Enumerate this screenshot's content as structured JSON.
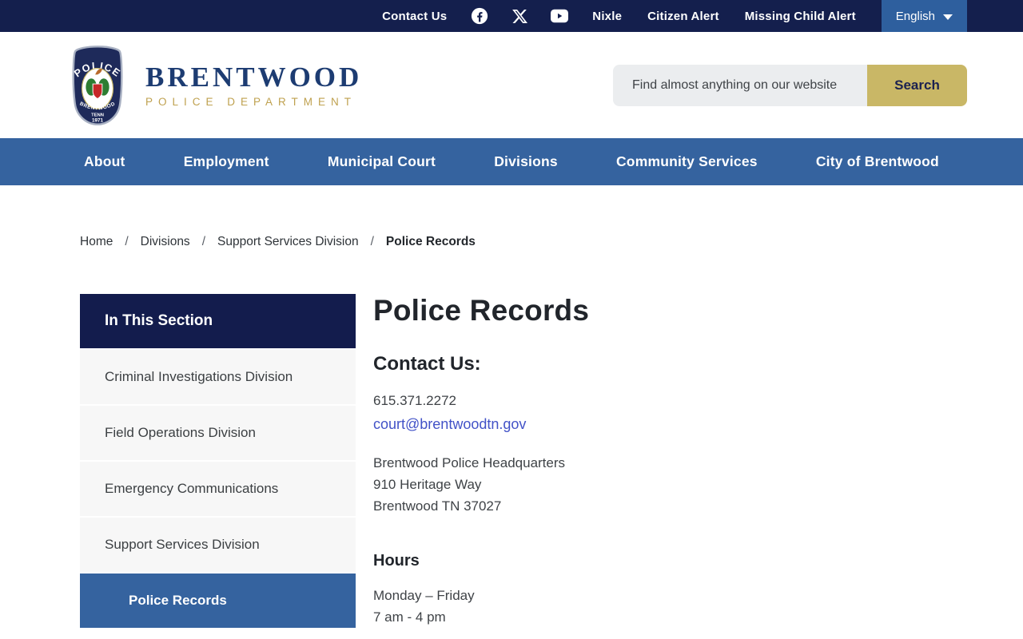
{
  "topbar": {
    "contact_us": "Contact Us",
    "links": [
      "Nixle",
      "Citizen Alert",
      "Missing Child Alert"
    ],
    "language": {
      "label": "English"
    }
  },
  "header": {
    "brand_name": "Brentwood",
    "brand_sub": "POLICE DEPARTMENT",
    "badge": {
      "top": "POLICE",
      "city": "BRENTWOOD",
      "state": "TENN",
      "year": "1971"
    },
    "search": {
      "placeholder": "Find almost anything on our website",
      "button": "Search"
    }
  },
  "nav": {
    "items": [
      "About",
      "Employment",
      "Municipal Court",
      "Divisions",
      "Community Services",
      "City of Brentwood"
    ]
  },
  "breadcrumb": {
    "separator": "/",
    "items": [
      "Home",
      "Divisions",
      "Support Services Division"
    ],
    "current": "Police Records"
  },
  "sidebar": {
    "title": "In This Section",
    "items": [
      "Criminal Investigations Division",
      "Field Operations Division",
      "Emergency Communications",
      "Support Services Division"
    ],
    "active": "Police Records"
  },
  "main": {
    "title": "Police Records",
    "contact": {
      "heading": "Contact Us:",
      "phone": "615.371.2272",
      "email": "court@brentwoodtn.gov",
      "address": [
        "Brentwood Police Headquarters",
        "910 Heritage Way",
        "Brentwood TN 37027"
      ]
    },
    "hours": {
      "heading": "Hours",
      "days": "Monday – Friday",
      "times": "7 am - 4 pm"
    }
  },
  "colors": {
    "navy": "#141f4d",
    "nav_blue": "#35639f",
    "language_blue": "#2e5f9e",
    "gold": "#c9b766",
    "link_blue": "#4252c7",
    "sidebar_item_bg": "#f7f7f7"
  }
}
